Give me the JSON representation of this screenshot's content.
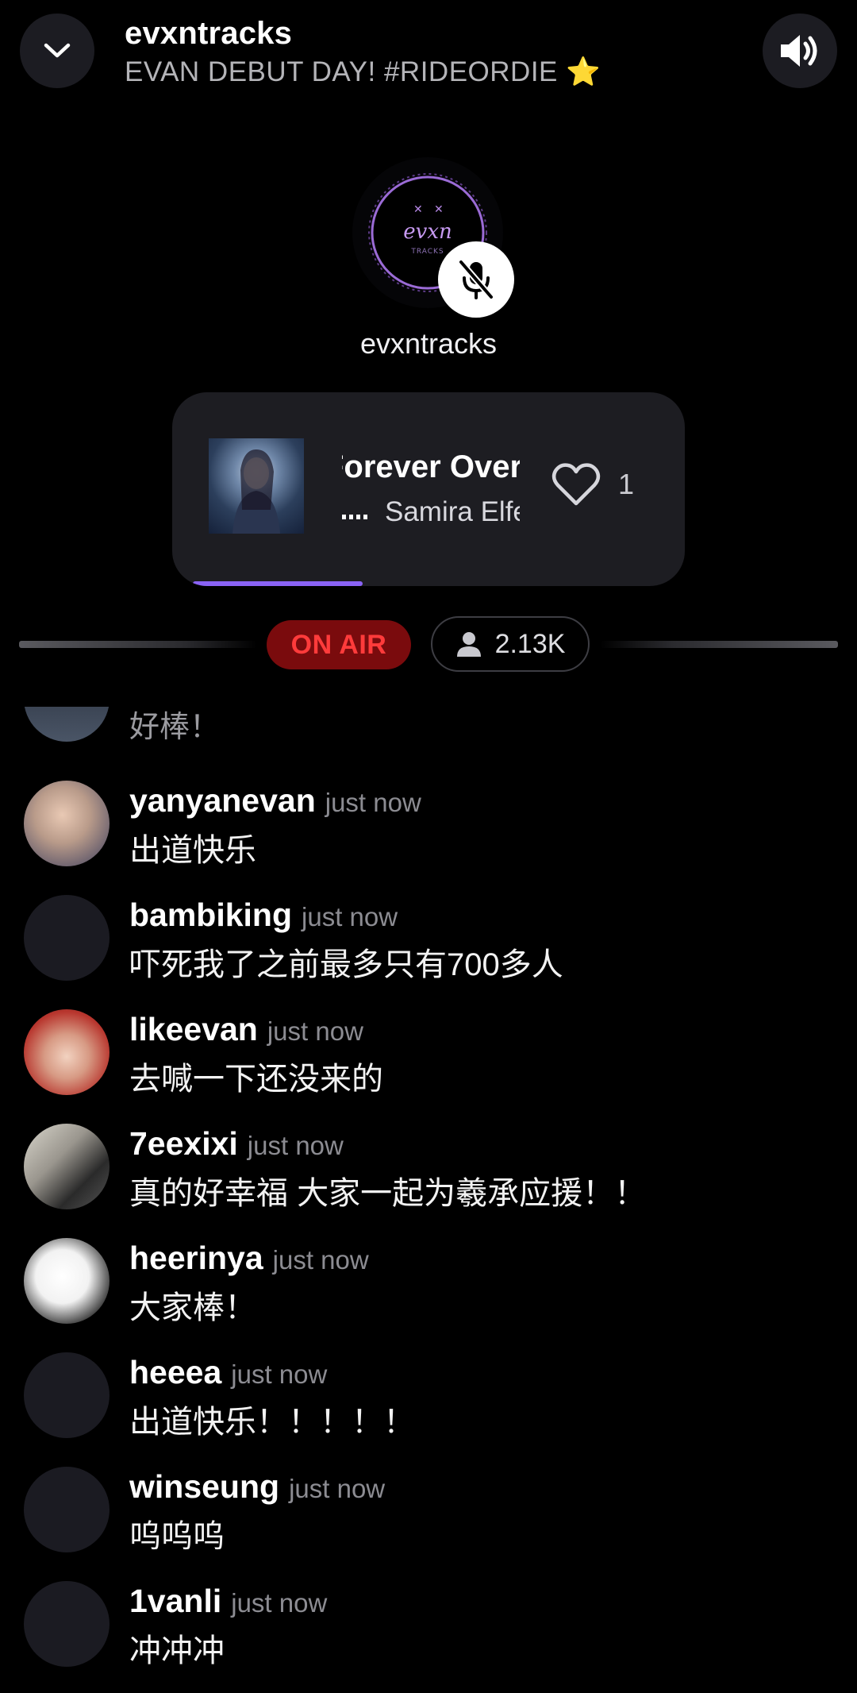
{
  "header": {
    "title": "evxntracks",
    "subtitle": "EVAN DEBUT DAY! #RIDEORDIE",
    "subtitle_emoji": "⭐"
  },
  "host": {
    "name": "evxntracks",
    "logo_text": "EVXNTRACKS",
    "mic_state": "muted"
  },
  "now_playing": {
    "title": "Forever Over",
    "artist": "Samira Elfeh",
    "likes": "1",
    "progress": 0.36
  },
  "status": {
    "on_air_label": "ON AIR",
    "listeners": "2.13K"
  },
  "partial_comment": {
    "text": "好棒！"
  },
  "comments": [
    {
      "user": "yanyanevan",
      "time": "just now",
      "text": "出道快乐"
    },
    {
      "user": "bambiking",
      "time": "just now",
      "text": "吓死我了之前最多只有700多人"
    },
    {
      "user": "likeevan",
      "time": "just now",
      "text": "去喊一下还没来的"
    },
    {
      "user": "7eexixi",
      "time": "just now",
      "text": "真的好幸福 大家一起为羲承应援！！"
    },
    {
      "user": "heerinya",
      "time": "just now",
      "text": "大家棒！"
    },
    {
      "user": "heeea",
      "time": "just now",
      "text": "出道快乐！！！！！"
    },
    {
      "user": "winseung",
      "time": "just now",
      "text": "呜呜呜"
    },
    {
      "user": "1vanli",
      "time": "just now",
      "text": "冲冲冲"
    }
  ],
  "colors": {
    "background": "#000000",
    "accent_progress": "#8a63f5",
    "on_air_bg": "#7a0b0d",
    "on_air_text": "#ff3b3b",
    "star": "#d8b13b"
  },
  "icons": {
    "back": "chevron-down-icon",
    "sound": "speaker-icon",
    "mic": "mic-off-icon",
    "like": "heart-icon",
    "listeners": "person-icon"
  }
}
